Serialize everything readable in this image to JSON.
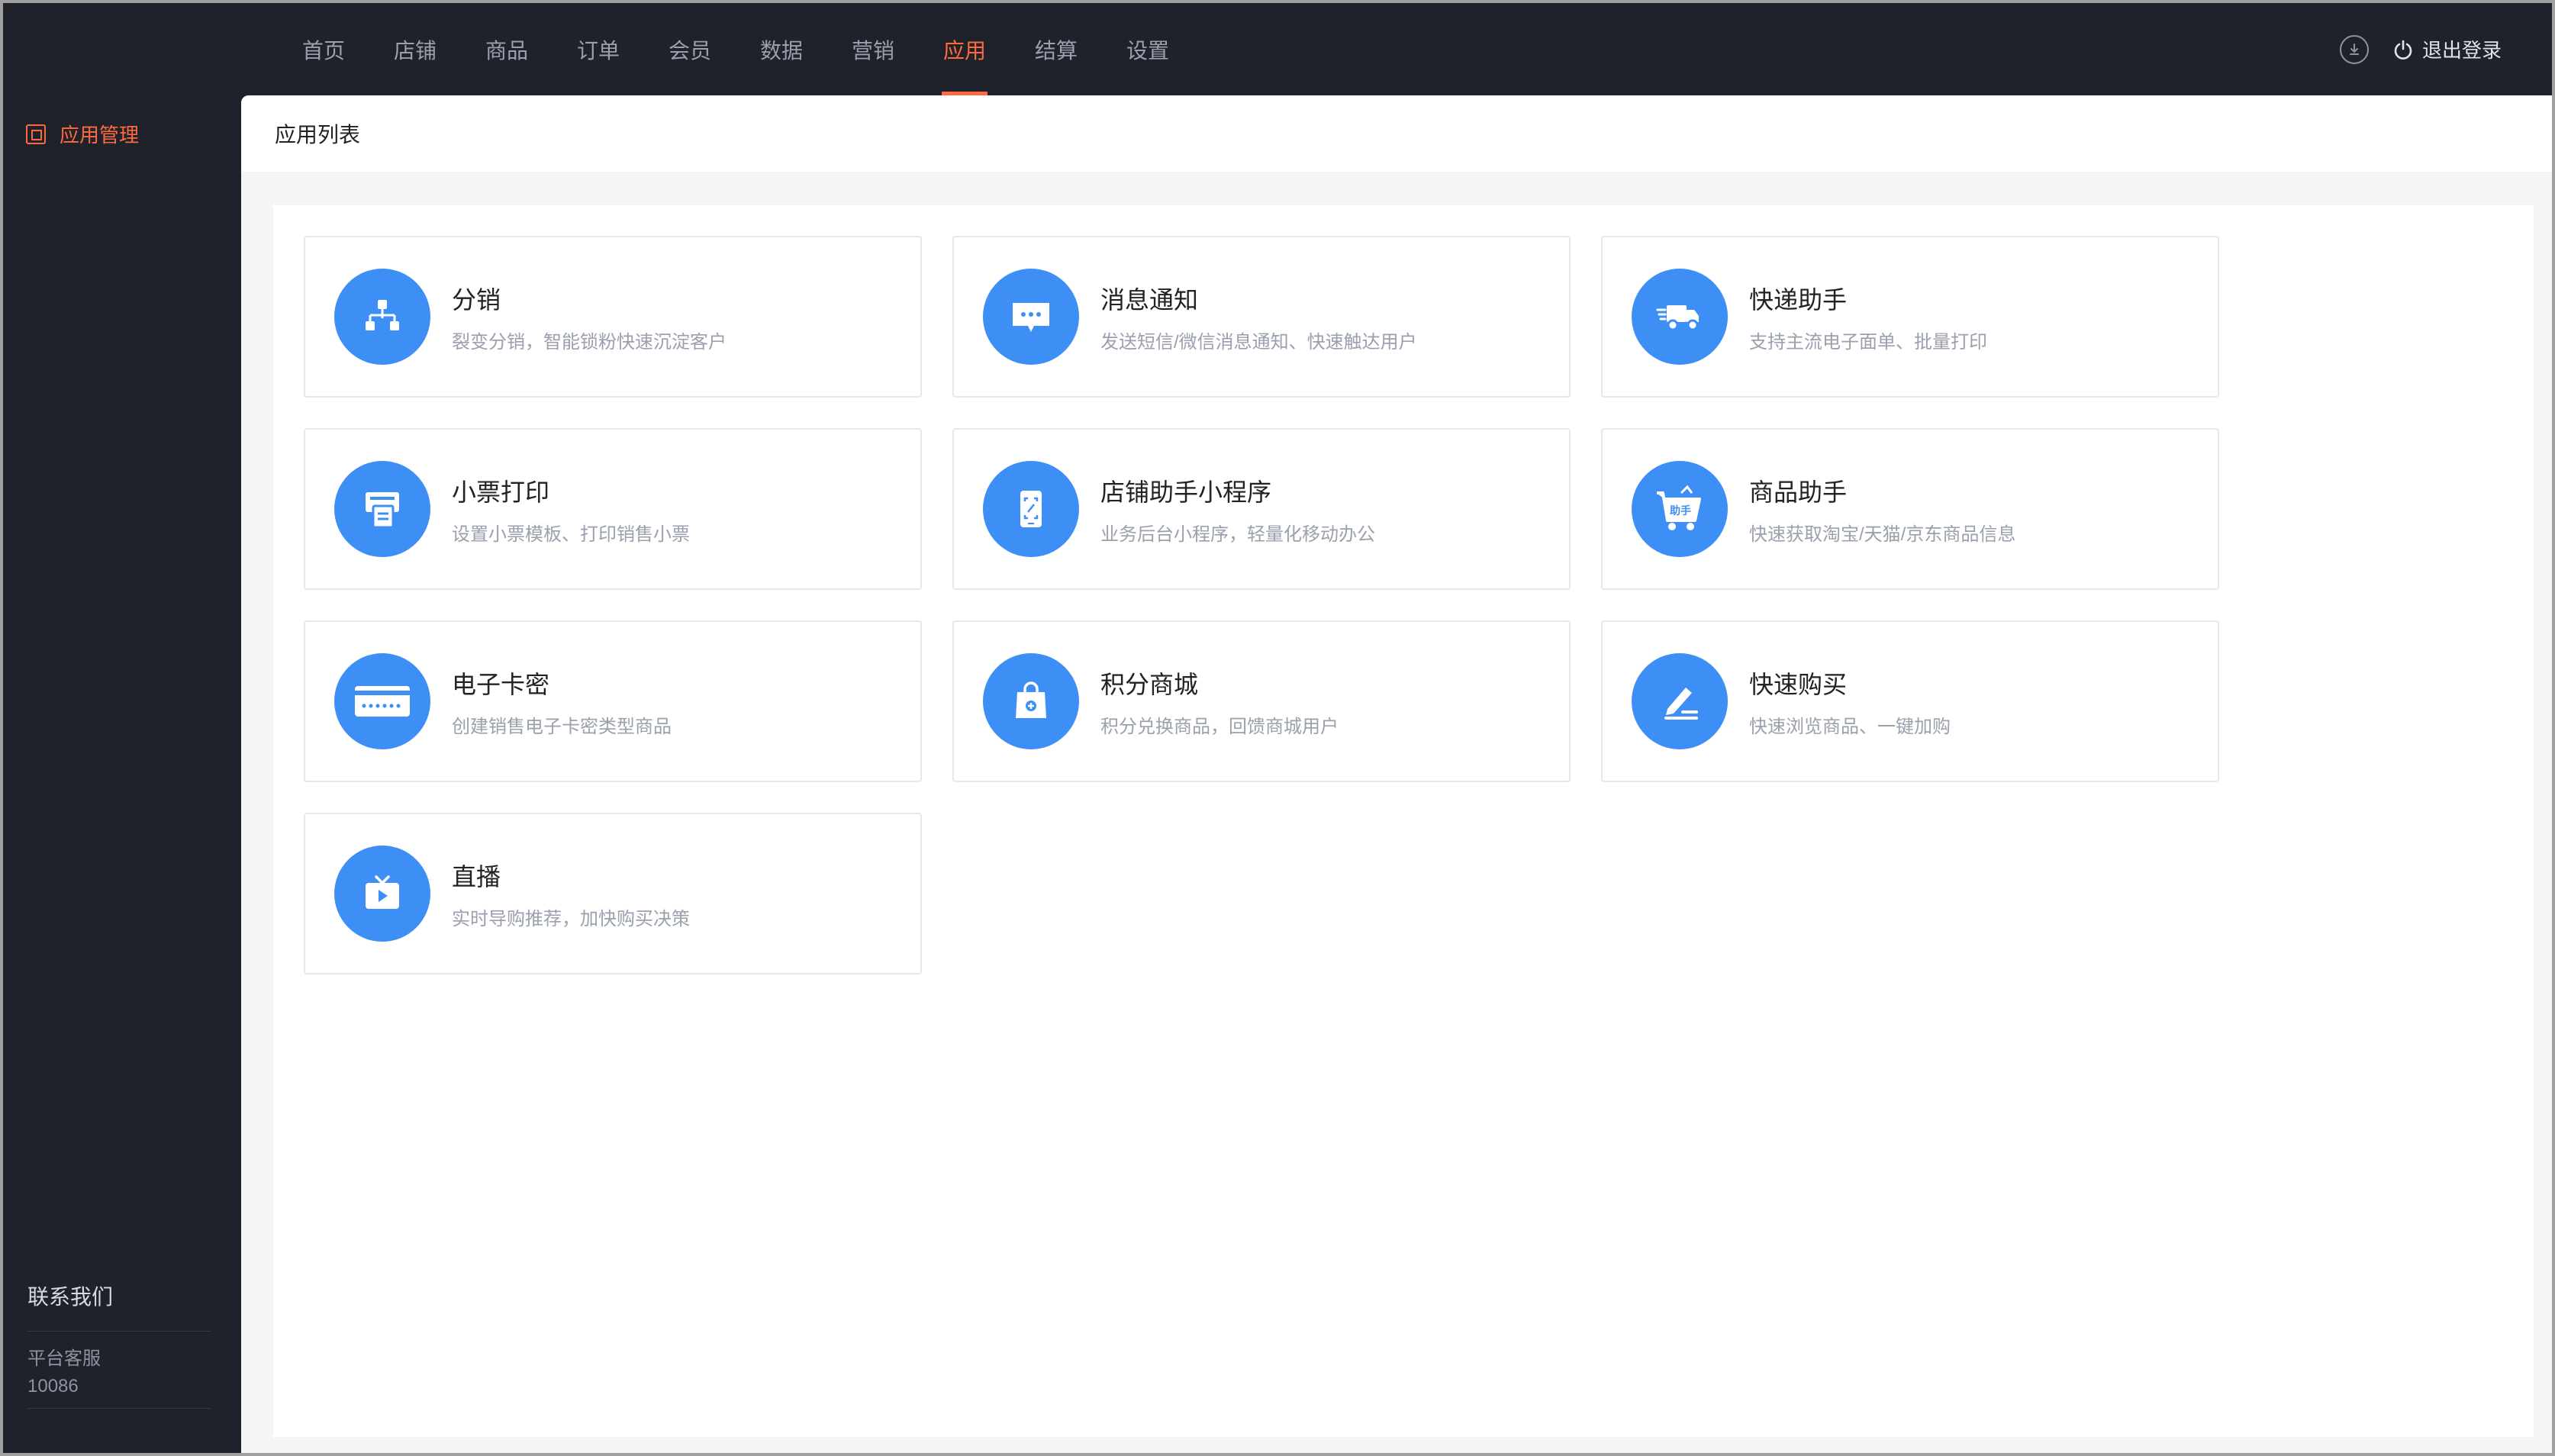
{
  "topnav": {
    "items": [
      {
        "label": "首页"
      },
      {
        "label": "店铺"
      },
      {
        "label": "商品"
      },
      {
        "label": "订单"
      },
      {
        "label": "会员"
      },
      {
        "label": "数据"
      },
      {
        "label": "营销"
      },
      {
        "label": "应用",
        "active": true
      },
      {
        "label": "结算"
      },
      {
        "label": "设置"
      }
    ],
    "download_icon": "download-icon",
    "logout_label": "退出登录",
    "accent_color": "#ff6a3d"
  },
  "sidebar": {
    "item_label": "应用管理",
    "contact_title": "联系我们",
    "contact_sub": "平台客服",
    "contact_phone": "10086"
  },
  "main": {
    "header_title": "应用列表",
    "apps": [
      {
        "title": "分销",
        "desc": "裂变分销，智能锁粉快速沉淀客户",
        "icon": "org-chart-icon"
      },
      {
        "title": "消息通知",
        "desc": "发送短信/微信消息通知、快速触达用户",
        "icon": "message-icon"
      },
      {
        "title": "快递助手",
        "desc": "支持主流电子面单、批量打印",
        "icon": "truck-icon"
      },
      {
        "title": "小票打印",
        "desc": "设置小票模板、打印销售小票",
        "icon": "printer-icon"
      },
      {
        "title": "店铺助手小程序",
        "desc": "业务后台小程序，轻量化移动办公",
        "icon": "mobile-icon"
      },
      {
        "title": "商品助手",
        "desc": "快速获取淘宝/天猫/京东商品信息",
        "icon": "cart-icon",
        "badge": "助手"
      },
      {
        "title": "电子卡密",
        "desc": "创建销售电子卡密类型商品",
        "icon": "card-icon"
      },
      {
        "title": "积分商城",
        "desc": "积分兑换商品，回馈商城用户",
        "icon": "bag-icon"
      },
      {
        "title": "快速购买",
        "desc": "快速浏览商品、一键加购",
        "icon": "pen-icon"
      },
      {
        "title": "直播",
        "desc": "实时导购推荐，加快购买决策",
        "icon": "tv-play-icon"
      }
    ],
    "icon_color": "#3d8ff5"
  }
}
